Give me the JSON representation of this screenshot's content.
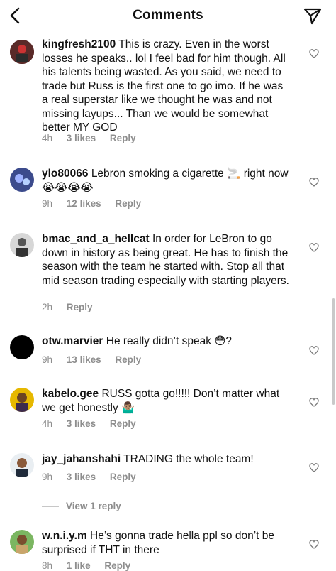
{
  "header": {
    "title": "Comments"
  },
  "comments": [
    {
      "username": "kingfresh2100",
      "text": "This is crazy. Even in the worst losses he speaks.. lol I feel bad for him though. All his talents being wasted. As you said, we need to trade but Russ is the first one to go imo. If he was a real superstar like we thought he was and not missing layups... Than we would be somewhat better MY GOD",
      "time": "4h",
      "likes": "3 likes",
      "reply": "Reply"
    },
    {
      "username": "ylo80066",
      "text": "Lebron smoking a cigarette 🚬 right now 😭😭😭😭",
      "time": "9h",
      "likes": "12 likes",
      "reply": "Reply"
    },
    {
      "username": "bmac_and_a_hellcat",
      "text": "In order for LeBron to go down in history as being great. He has to finish the season with the team he started with. Stop all that mid season trading especially with starting players.",
      "time": "2h",
      "likes": "",
      "reply": "Reply"
    },
    {
      "username": "otw.marvier",
      "text": "He really didn’t speak 😳?",
      "time": "9h",
      "likes": "13 likes",
      "reply": "Reply"
    },
    {
      "username": "kabelo.gee",
      "text": "RUSS gotta go!!!!! Don’t matter what we get honestly 🤷🏽‍♂️",
      "time": "4h",
      "likes": "3 likes",
      "reply": "Reply"
    },
    {
      "username": "jay_jahanshahi",
      "text": "TRADING the whole team!",
      "time": "9h",
      "likes": "3 likes",
      "reply": "Reply"
    },
    {
      "username": "w.n.i.y.m",
      "text": "He’s gonna trade hella ppl so don’t be surprised if THT in there",
      "time": "8h",
      "likes": "1 like",
      "reply": "Reply"
    }
  ],
  "view_replies": "View 1 reply",
  "icons": {
    "back": "chevron-left-icon",
    "send": "paper-plane-icon",
    "like": "heart-icon"
  }
}
